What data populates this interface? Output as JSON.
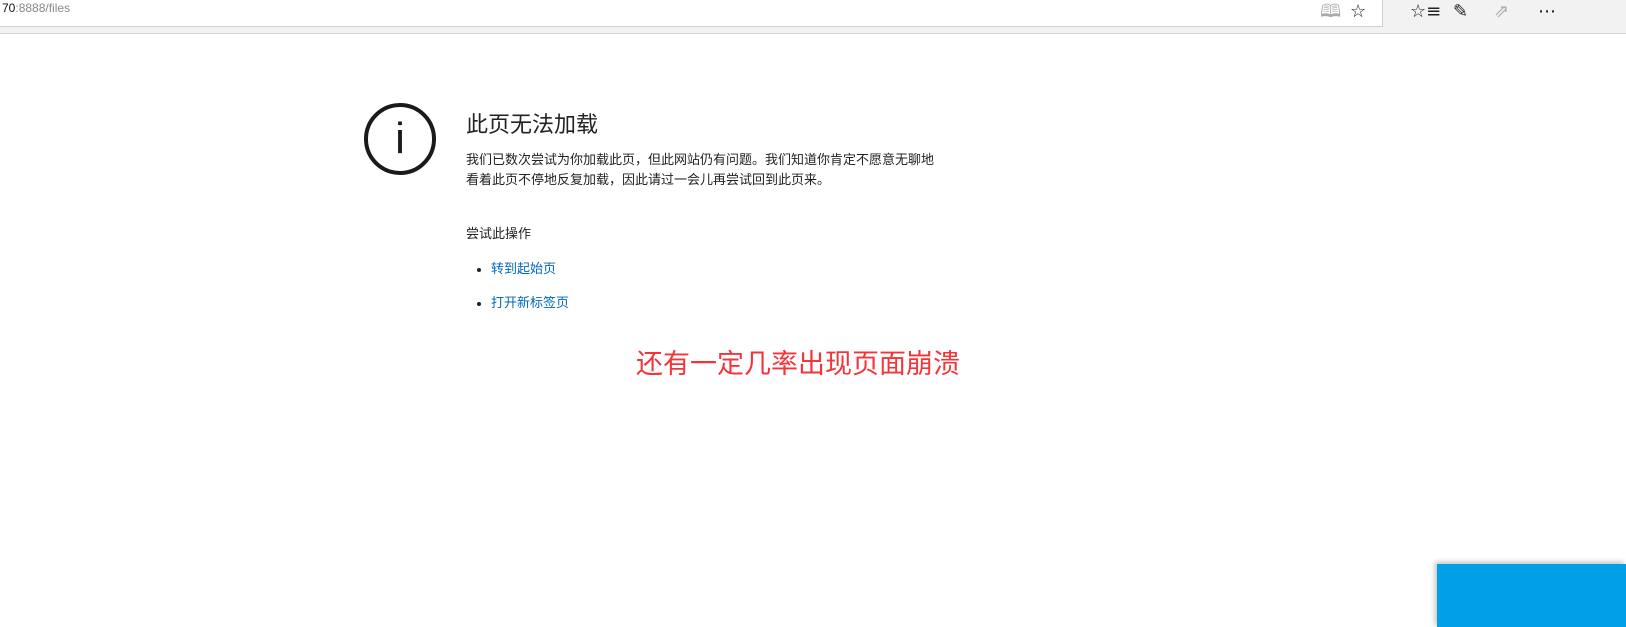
{
  "browser": {
    "url_host": "70",
    "url_rest": ":8888/files",
    "icons": [
      "reading-view-icon",
      "favorite-star-icon",
      "favorites-hub-icon",
      "web-note-icon",
      "share-icon",
      "more-icon"
    ]
  },
  "error": {
    "title": "此页无法加载",
    "description": "我们已数次尝试为你加载此页，但此网站仍有问题。我们知道你肯定不愿意无聊地看着此页不停地反复加载，因此请过一会儿再尝试回到此页来。",
    "try_heading": "尝试此操作",
    "actions": [
      "转到起始页",
      "打开新标签页"
    ]
  },
  "annotation": "还有一定几率出现页面崩溃",
  "colors": {
    "link": "#0067b8",
    "annotation": "#f5343a",
    "panel": "#00a0e8"
  }
}
